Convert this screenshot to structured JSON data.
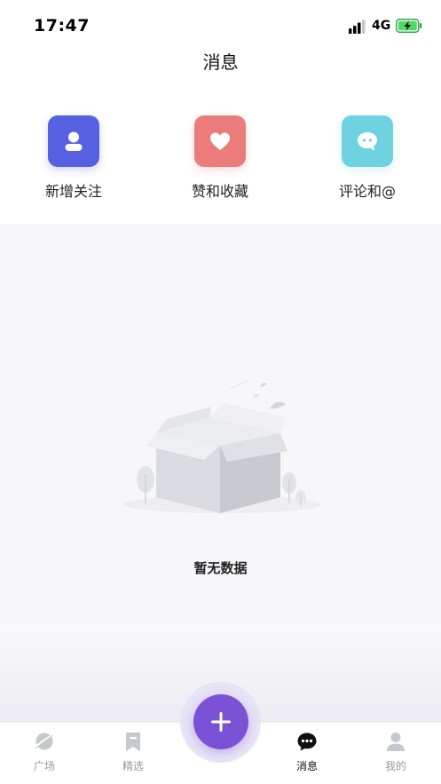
{
  "status_bar": {
    "time": "17:47",
    "network": "4G",
    "signal_icon": "signal-icon",
    "battery_icon": "battery-charging-icon"
  },
  "header": {
    "title": "消息"
  },
  "shortcuts": [
    {
      "label": "新增关注",
      "icon": "person-icon",
      "color": "#5561e0"
    },
    {
      "label": "赞和收藏",
      "icon": "heart-icon",
      "color": "#ec7b7b"
    },
    {
      "label": "评论和@",
      "icon": "chat-bubble-icon",
      "color": "#6fd2e0"
    }
  ],
  "empty_state": {
    "text": "暂无数据",
    "illustration": "empty-box-icon"
  },
  "fab": {
    "icon": "plus-icon",
    "color": "#7b52d6"
  },
  "tab_bar": {
    "tabs": [
      {
        "label": "广场",
        "icon": "planet-icon",
        "active": false
      },
      {
        "label": "精选",
        "icon": "bookmark-icon",
        "active": false
      },
      {
        "label": "消息",
        "icon": "message-icon",
        "active": true
      },
      {
        "label": "我的",
        "icon": "user-icon",
        "active": false
      }
    ]
  }
}
